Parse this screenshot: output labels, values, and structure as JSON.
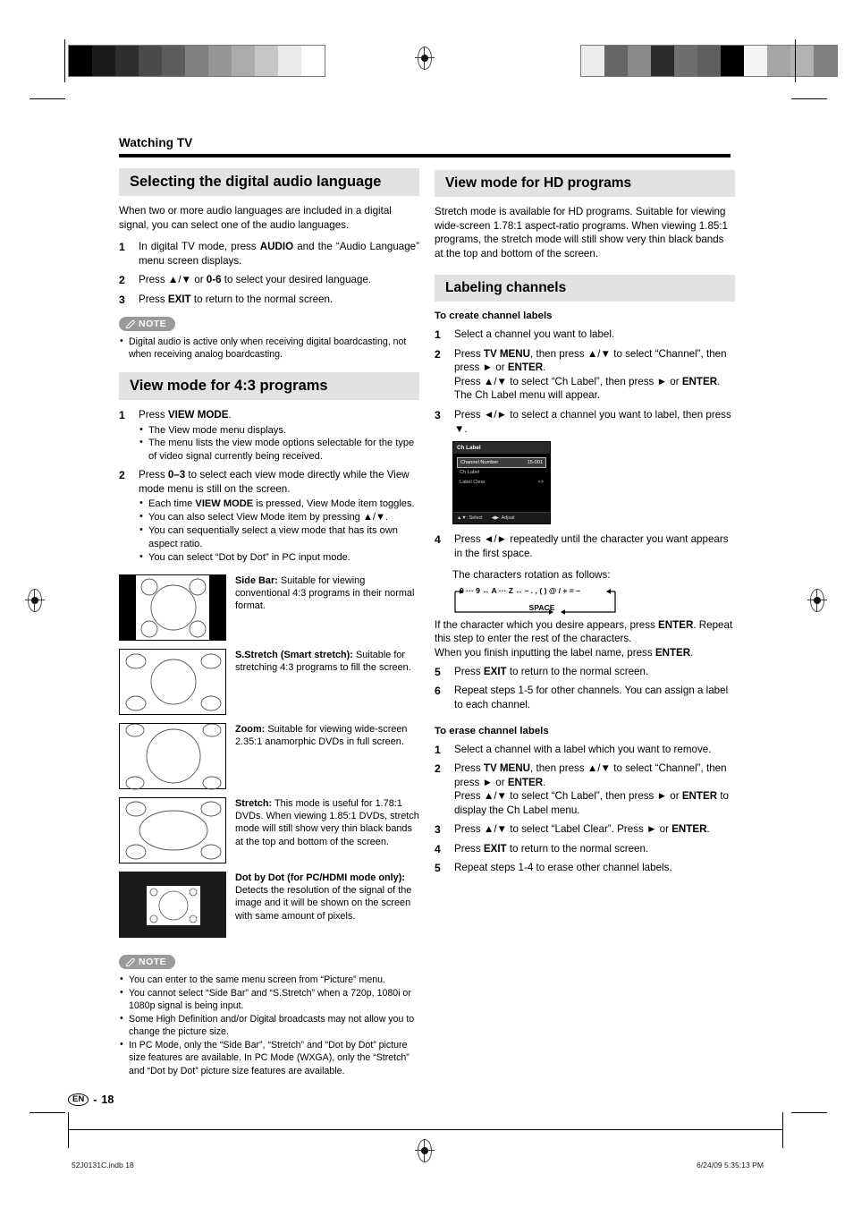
{
  "document": {
    "running_head": "Watching TV",
    "page_label": "18",
    "language_mark": "EN",
    "page_number_separator": "-"
  },
  "printmarks": {
    "left_bar_swatches": [
      "#000000",
      "#1b1b1b",
      "#2e2e2e",
      "#4a4a4a",
      "#5c5c5c",
      "#808080",
      "#969696",
      "#ababab",
      "#c6c6c6",
      "#e9e9e9",
      "#ffffff"
    ],
    "right_bar_swatches": [
      "#ececec",
      "#666666",
      "#8a8a8a",
      "#2b2b2b",
      "#6f6f6f",
      "#5f5f5f",
      "#000000",
      "#f4f4f4",
      "#a6a6a6",
      "#b3b3b3",
      "#808080"
    ]
  },
  "left_column": {
    "section1": {
      "heading": "Selecting the digital audio language",
      "intro": "When two or more audio languages are included in a digital signal, you can select one of the audio languages.",
      "steps": [
        {
          "num": "1",
          "text": "In digital TV mode, press AUDIO and the “Audio Language” menu screen displays."
        },
        {
          "num": "2",
          "text": "Press ▲/▼ or 0-6 to select your desired language."
        },
        {
          "num": "3",
          "text": "Press EXIT to return to the normal screen."
        }
      ],
      "note_label": "NOTE",
      "notes": [
        "Digital audio is active only when receiving digital boardcasting, not when receiving analog boardcasting."
      ]
    },
    "section2": {
      "heading": "View mode for 4:3 programs",
      "steps": [
        {
          "num": "1",
          "text": "Press VIEW MODE.",
          "bullets": [
            "The View mode menu displays.",
            "The menu lists the view mode options selectable for the type of video signal currently being received."
          ]
        },
        {
          "num": "2",
          "text": "Press 0–3 to select each view mode directly while the View mode menu is still on the screen.",
          "bullets": [
            "Each time VIEW MODE is pressed, View Mode item toggles.",
            "You can also select View Mode item by pressing ▲/▼.",
            "You can sequentially select a view mode that has its own aspect ratio.",
            "You can select “Dot by Dot” in PC input mode."
          ]
        }
      ],
      "view_modes": [
        {
          "figure": "side-bar",
          "title": "Side Bar:",
          "description": "Suitable for viewing conventional 4:3 programs in their normal format."
        },
        {
          "figure": "s-stretch",
          "title": "S.Stretch (Smart stretch):",
          "description": "Suitable for stretching 4:3 programs to fill the screen."
        },
        {
          "figure": "zoom",
          "title": "Zoom:",
          "description": "Suitable for viewing wide-screen 2.35:1 anamorphic DVDs in full screen."
        },
        {
          "figure": "stretch",
          "title": "Stretch:",
          "description": "This mode is useful for 1.78:1 DVDs. When viewing 1.85:1 DVDs, stretch mode will still show very thin black bands at the top and bottom of the screen."
        },
        {
          "figure": "dot-by-dot",
          "title": "Dot by Dot (for PC/HDMI mode only):",
          "description": "Detects the resolution of the signal of the image and it will be shown on the screen with same amount of pixels."
        }
      ],
      "note_label": "NOTE",
      "notes": [
        "You can enter to the same menu screen from “Picture” menu.",
        "You cannot select “Side Bar” and “S.Stretch” when a 720p, 1080i or 1080p signal is being input.",
        "Some High Definition and/or Digital broadcasts may not allow you to change the picture size.",
        "In PC Mode, only the “Side Bar”, “Stretch” and “Dot by Dot” picture size features are available. In PC Mode (WXGA), only the “Stretch” and “Dot by Dot” picture size features are available."
      ]
    }
  },
  "right_column": {
    "section3": {
      "heading": "View mode for HD programs",
      "body": "Stretch mode is available for HD programs. Suitable for viewing wide-screen 1.78:1 aspect-ratio programs. When viewing 1.85:1 programs, the stretch mode will still show very thin black bands at the top and bottom of the screen."
    },
    "section4": {
      "heading": "Labeling channels",
      "subsection_create": {
        "title": "To create channel labels",
        "steps": [
          {
            "num": "1",
            "text": "Select a channel you want to label."
          },
          {
            "num": "2",
            "text": "Press TV MENU, then press ▲/▼ to select “Channel”, then press ▶ or ENTER. Press ▲/▼ to select “Ch Label”, then press ▶ or ENTER. The Ch Label menu will appear."
          },
          {
            "num": "3",
            "text": "Press ◀/▶ to select a channel you want to label, then press ▼."
          },
          {
            "num": "4",
            "text": "Press ◀/▶ repeatedly until the character you want appears in the first space."
          },
          {
            "num": "5",
            "text": "Press EXIT to return to the normal screen."
          },
          {
            "num": "6",
            "text": "Repeat steps 1-5 for other channels. You can assign a label to each channel."
          }
        ],
        "rotation_intro": "The characters rotation as follows:",
        "rotation_diagram": {
          "digits": "0 ··· 9",
          "letters": "A ··· Z",
          "symbols": "– . , ( ) @ / + = –",
          "space": "SPACE",
          "link": "↔"
        },
        "after_rotation": "If the character which you desire appears, press ENTER. Repeat this step to enter the rest of the characters. When you finish inputting the label name, press ENTER."
      },
      "osd": {
        "title": "Ch Label",
        "rows": [
          {
            "label": "Channel Number",
            "value": "15-001",
            "selected": true
          },
          {
            "label": "Ch Label",
            "value": "",
            "selected": false
          },
          {
            "label": "Label Clear",
            "value": ">>",
            "selected": false
          }
        ],
        "footer": [
          {
            "keys": "▲▼",
            "action": ": Select"
          },
          {
            "keys": "◀▶",
            "action": ": Adjust"
          }
        ]
      },
      "subsection_erase": {
        "title": "To erase channel labels",
        "steps": [
          {
            "num": "1",
            "text": "Select a channel with a label which you want to remove."
          },
          {
            "num": "2",
            "text": "Press TV MENU, then press ▲/▼ to select “Channel”, then press ▶ or ENTER. Press ▲/▼ to select “Ch Label”, then press ▶ or ENTER to display the Ch Label menu."
          },
          {
            "num": "3",
            "text": "Press ▲/▼ to select “Label Clear”. Press ▶ or ENTER."
          },
          {
            "num": "4",
            "text": "Press EXIT to return to the normal screen."
          },
          {
            "num": "5",
            "text": "Repeat steps 1-4 to erase other channel labels."
          }
        ]
      }
    }
  },
  "footer": {
    "file_name": "52J0131C.indb   18",
    "timestamp": "6/24/09   5:35:13 PM"
  }
}
